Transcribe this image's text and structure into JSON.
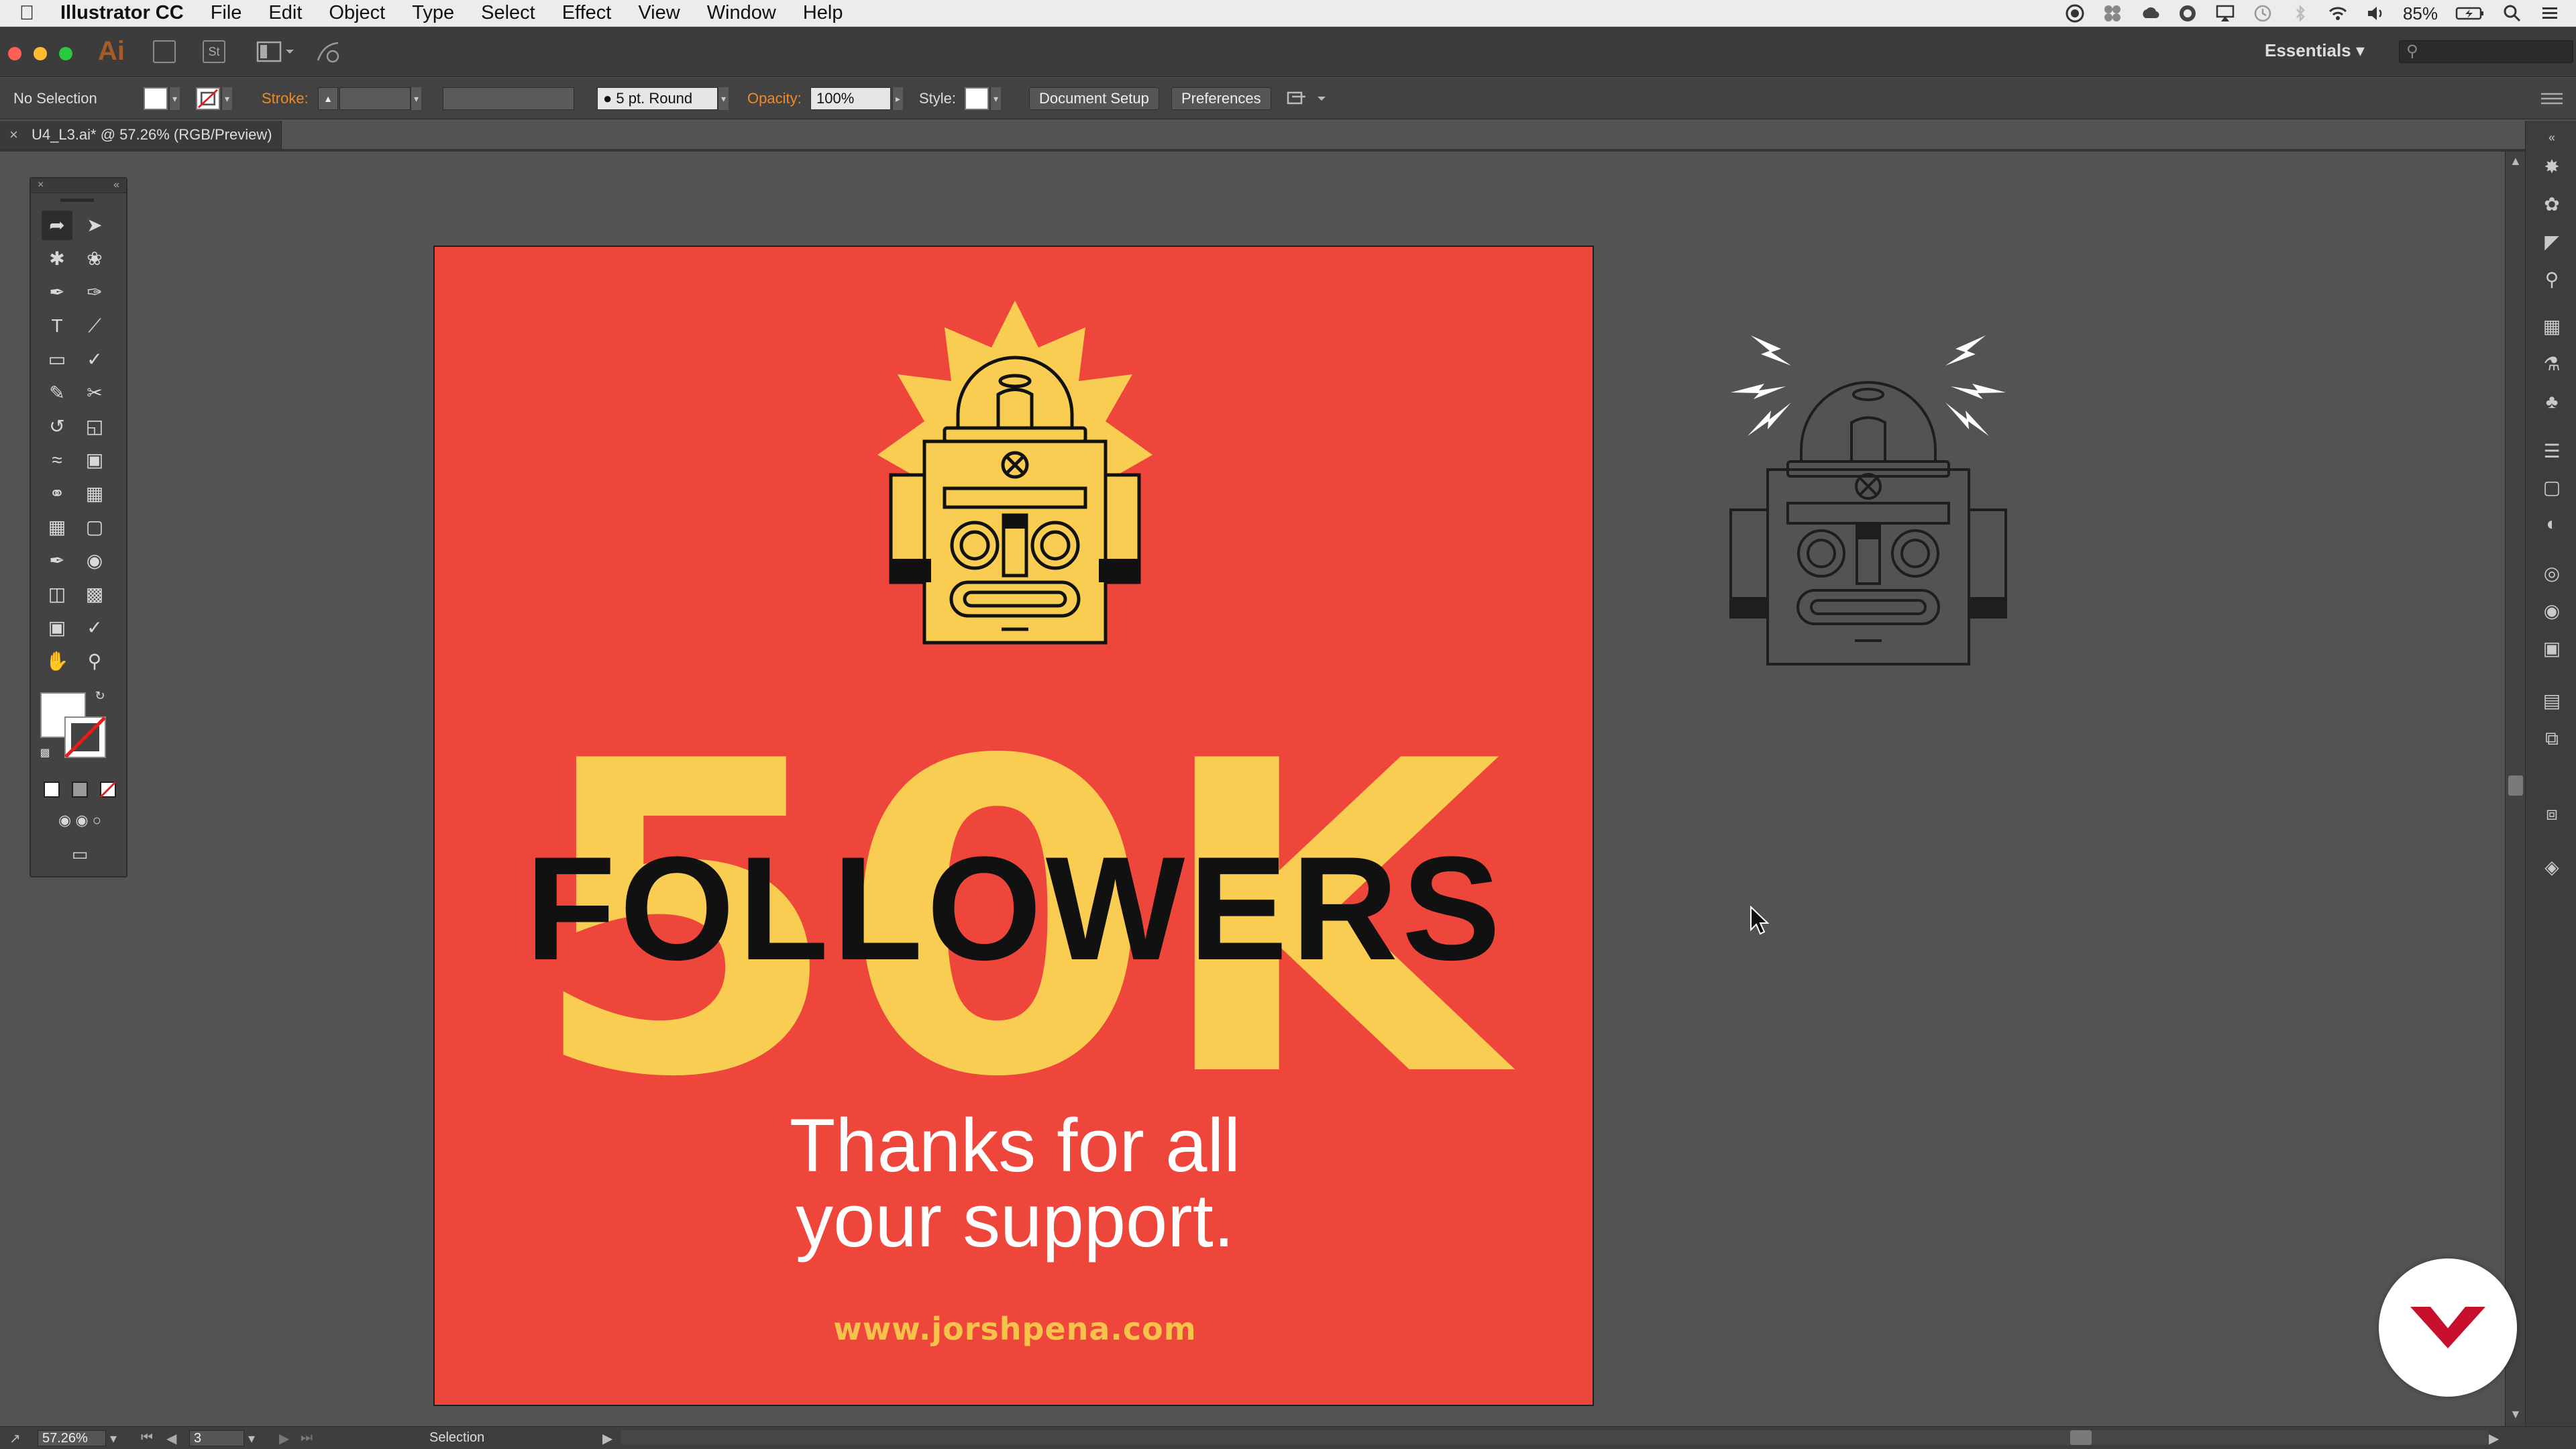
{
  "menubar": {
    "app_name": "Illustrator CC",
    "items": [
      "File",
      "Edit",
      "Object",
      "Type",
      "Select",
      "Effect",
      "View",
      "Window",
      "Help"
    ],
    "battery": "85%"
  },
  "appbar": {
    "logo": "Ai",
    "st_icon": "St",
    "workspace": "Essentials",
    "colors": {
      "close": "#ff5f57",
      "minimize": "#febc2e",
      "zoom": "#28c840"
    }
  },
  "control": {
    "selection_state": "No Selection",
    "stroke_label": "Stroke:",
    "brush_value": "5 pt. Round",
    "opacity_label": "Opacity:",
    "opacity_value": "100%",
    "style_label": "Style:",
    "document_setup": "Document Setup",
    "preferences": "Preferences"
  },
  "document": {
    "tab_close": "×",
    "tab_title": "U4_L3.ai* @ 57.26% (RGB/Preview)"
  },
  "artwork": {
    "big_number": "50K",
    "headline": "FOLLOWERS",
    "thanks_line1": "Thanks for all",
    "thanks_line2": "your support.",
    "url": "www.jorshpena.com",
    "colors": {
      "background": "#ee463a",
      "accent": "#f9cd52",
      "ink": "#111111",
      "text": "#ffffff",
      "url": "#f6c24a"
    }
  },
  "statusbar": {
    "zoom": "57.26%",
    "artboard_number": "3",
    "tool_name": "Selection"
  }
}
